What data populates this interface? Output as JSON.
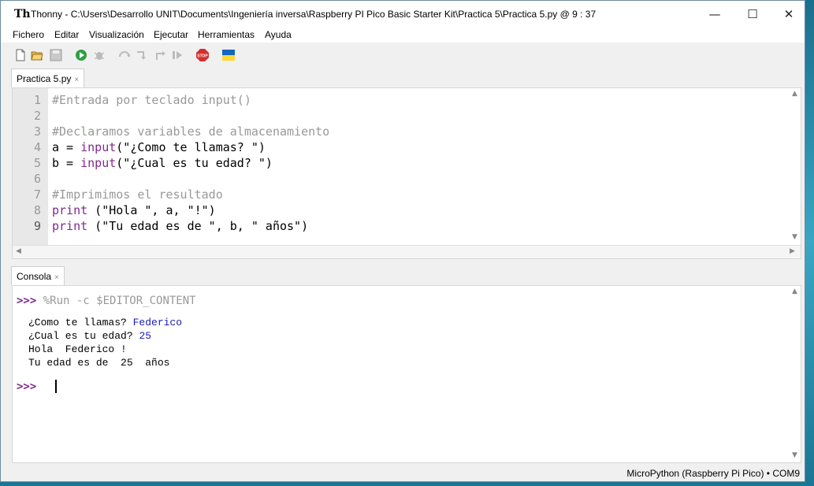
{
  "window": {
    "app_name": "Thonny",
    "title": "Thonny  -  C:\\Users\\Desarrollo UNIT\\Documents\\Ingeniería inversa\\Raspberry PI Pico Basic Starter Kit\\Practica 5\\Practica 5.py  @  9 : 37",
    "minimize_glyph": "—",
    "maximize_glyph": "☐",
    "close_glyph": "✕"
  },
  "menu": {
    "items": [
      "Fichero",
      "Editar",
      "Visualización",
      "Ejecutar",
      "Herramientas",
      "Ayuda"
    ]
  },
  "toolbar": {
    "icons": [
      "new-file-icon",
      "open-file-icon",
      "save-icon",
      "run-icon",
      "debug-icon",
      "step-over-icon",
      "step-into-icon",
      "step-out-icon",
      "resume-icon",
      "stop-icon",
      "ukraine-flag-icon"
    ],
    "stop_label": "STOP"
  },
  "editor": {
    "tab_label": "Practica 5.py",
    "tab_close": "×",
    "line_numbers": [
      "1",
      "2",
      "3",
      "4",
      "5",
      "6",
      "7",
      "8",
      "9"
    ],
    "lines": [
      "#Entrada por teclado input()",
      "",
      "#Declaramos variables de almacenamiento",
      "a = input(\"¿Como te llamas? \")",
      "b = input(\"¿Cual es tu edad? \")",
      "",
      "#Imprimimos el resultado",
      "print (\"Hola \", a, \"!\")",
      "print (\"Tu edad es de \", b, \" años\")"
    ]
  },
  "shell": {
    "tab_label": "Consola",
    "tab_close": "×",
    "prompt": ">>>",
    "run_command": "%Run -c $EDITOR_CONTENT",
    "output": [
      {
        "text": "¿Como te llamas? ",
        "input": "Federico"
      },
      {
        "text": "¿Cual es tu edad? ",
        "input": "25"
      },
      {
        "text": "Hola  Federico !",
        "input": ""
      },
      {
        "text": "Tu edad es de  25  años",
        "input": ""
      }
    ]
  },
  "status": {
    "text": "MicroPython (Raspberry Pi Pico)  •  COM9"
  }
}
